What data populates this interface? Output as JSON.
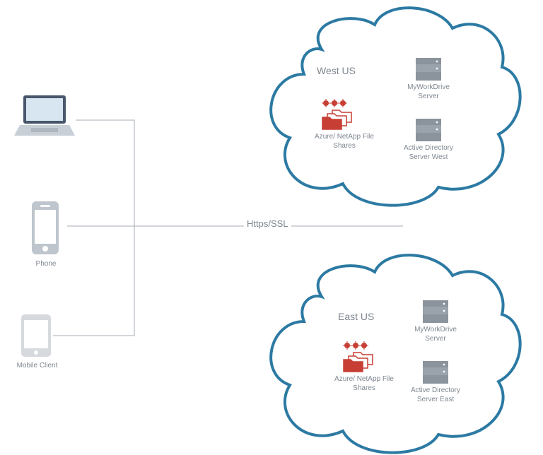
{
  "devices": {
    "laptop": {
      "label": ""
    },
    "phone": {
      "label": "Phone"
    },
    "mobile_client": {
      "label": "Mobile Client"
    }
  },
  "connection": {
    "protocol_label": "Https/SSL"
  },
  "clouds": [
    {
      "region_label": "West US",
      "file_shares_label": "Azure/ NetApp File Shares",
      "server1_label": "MyWorkDrive\nServer",
      "server2_label": "Active Directory\nServer West"
    },
    {
      "region_label": "East US",
      "file_shares_label": "Azure/ NetApp File Shares",
      "server1_label": "MyWorkDrive\nServer",
      "server2_label": "Active Directory\nServer East"
    }
  ],
  "colors": {
    "cloud_stroke": "#2c7aa3",
    "text": "#7e8690",
    "accent_red": "#c73f34",
    "server_fill": "#9aa2ab",
    "line": "#a7adb4"
  }
}
